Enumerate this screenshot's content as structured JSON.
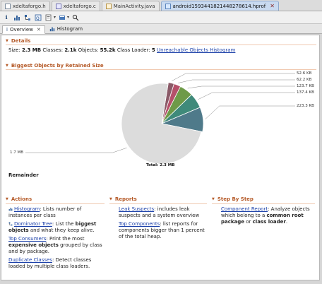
{
  "editor_tabs": [
    {
      "label": "xdeltaforgo.h",
      "icon": "h-file-icon"
    },
    {
      "label": "xdeltaforgo.c",
      "icon": "c-file-icon"
    },
    {
      "label": "MainActivity.java",
      "icon": "java-file-icon"
    },
    {
      "label": "android1593441821448278614.hprof",
      "icon": "hprof-file-icon",
      "active": true
    }
  ],
  "toolbar": {
    "buttons": [
      "info-icon",
      "histogram-icon",
      "dominator-tree-icon",
      "oql-icon",
      "report-dropdown-icon",
      "query-dropdown-icon",
      "search-icon"
    ]
  },
  "view_tabs": [
    {
      "label": "Overview",
      "active": true
    },
    {
      "label": "Histogram"
    }
  ],
  "details": {
    "heading": "Details",
    "size_label": "Size:",
    "size_value": "2.3 MB",
    "classes_label": "Classes:",
    "classes_value": "2.1k",
    "objects_label": "Objects:",
    "objects_value": "55.2k",
    "loader_label": "Class Loader:",
    "loader_value": "5",
    "unreachable_link": "Unreachable Objects Histogram"
  },
  "biggest": {
    "heading": "Biggest Objects by Retained Size",
    "labels": [
      "52.6 KB",
      "62.2 KB",
      "123.7 KB",
      "137.4 KB",
      "223.3 KB",
      "1.7 MB"
    ],
    "total": "Total: 2.3 MB",
    "remainder": "Remainder"
  },
  "chart_data": {
    "type": "pie",
    "title": "",
    "total": "Total: 2.3 MB",
    "slices": [
      {
        "label": "52.6 KB",
        "value": 52.6,
        "color": "#8a5a68"
      },
      {
        "label": "62.2 KB",
        "value": 62.2,
        "color": "#b5506a"
      },
      {
        "label": "123.7 KB",
        "value": 123.7,
        "color": "#6e9a48"
      },
      {
        "label": "137.4 KB",
        "value": 137.4,
        "color": "#3f8a7a"
      },
      {
        "label": "223.3 KB",
        "value": 223.3,
        "color": "#4f7a8a"
      },
      {
        "label": "1.7 MB",
        "value": 1740.8,
        "color": "#dcdcdc"
      }
    ]
  },
  "actions": {
    "heading": "Actions",
    "items": [
      {
        "link": "Histogram",
        "text": ": Lists number of instances per class"
      },
      {
        "link": "Dominator Tree",
        "text1": ": List the ",
        "bold": "biggest objects",
        "text2": " and what they keep alive."
      },
      {
        "link": "Top Consumers",
        "text1": ": Print the most ",
        "bold": "expensive objects",
        "text2": " grouped by class and by package."
      },
      {
        "link": "Duplicate Classes",
        "text": ": Detect classes loaded by multiple class loaders."
      }
    ]
  },
  "reports": {
    "heading": "Reports",
    "items": [
      {
        "link": "Leak Suspects",
        "text": ": includes leak suspects and a system overview"
      },
      {
        "link": "Top Components",
        "text": ": list reports for components bigger than 1 percent of the total heap."
      }
    ]
  },
  "steps": {
    "heading": "Step By Step",
    "items": [
      {
        "link": "Component Report",
        "text1": ": Analyze objects which belong to a ",
        "bold1": "common root package",
        "text2": " or ",
        "bold2": "class loader",
        "text3": "."
      }
    ]
  }
}
